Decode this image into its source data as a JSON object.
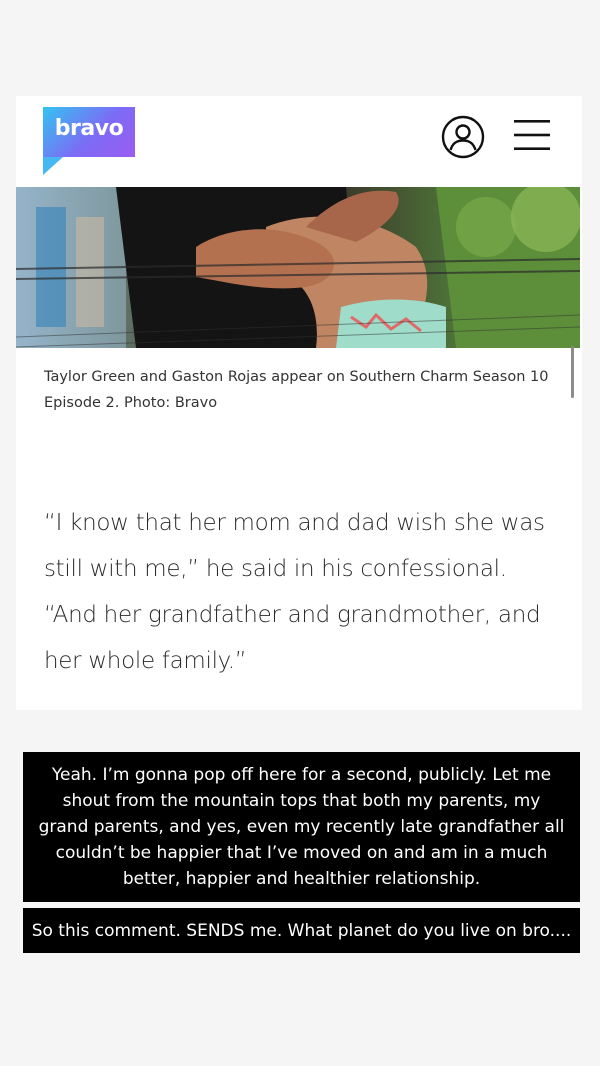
{
  "header": {
    "logo_text": "bravo",
    "user_icon": "user-circle-icon",
    "menu_icon": "hamburger-menu-icon"
  },
  "article": {
    "image_caption": "Taylor Green and Gaston Rojas appear on Southern Charm Season 10 Episode 2. Photo: Bravo",
    "quote": "“I know that her mom and dad wish she was still with me,” he said in his confessional. “And her grandfather and grandmother, and her whole family.”"
  },
  "story_overlay": {
    "text_1": "Yeah. I’m gonna pop off here for a second, publicly. Let me shout from the mountain tops that both my parents, my grand parents, and yes, even my recently late grandfather all couldn’t be happier that I’ve moved on and am in a much better, happier and healthier relationship.",
    "text_2": "So this comment. SENDS me. What planet do you live on bro...."
  },
  "colors": {
    "background": "#f5f5f5",
    "card": "#ffffff",
    "overlay_bg": "#000000",
    "overlay_text": "#ffffff",
    "logo_gradient_start": "#33c4f0",
    "logo_gradient_end": "#9b5cf0"
  }
}
